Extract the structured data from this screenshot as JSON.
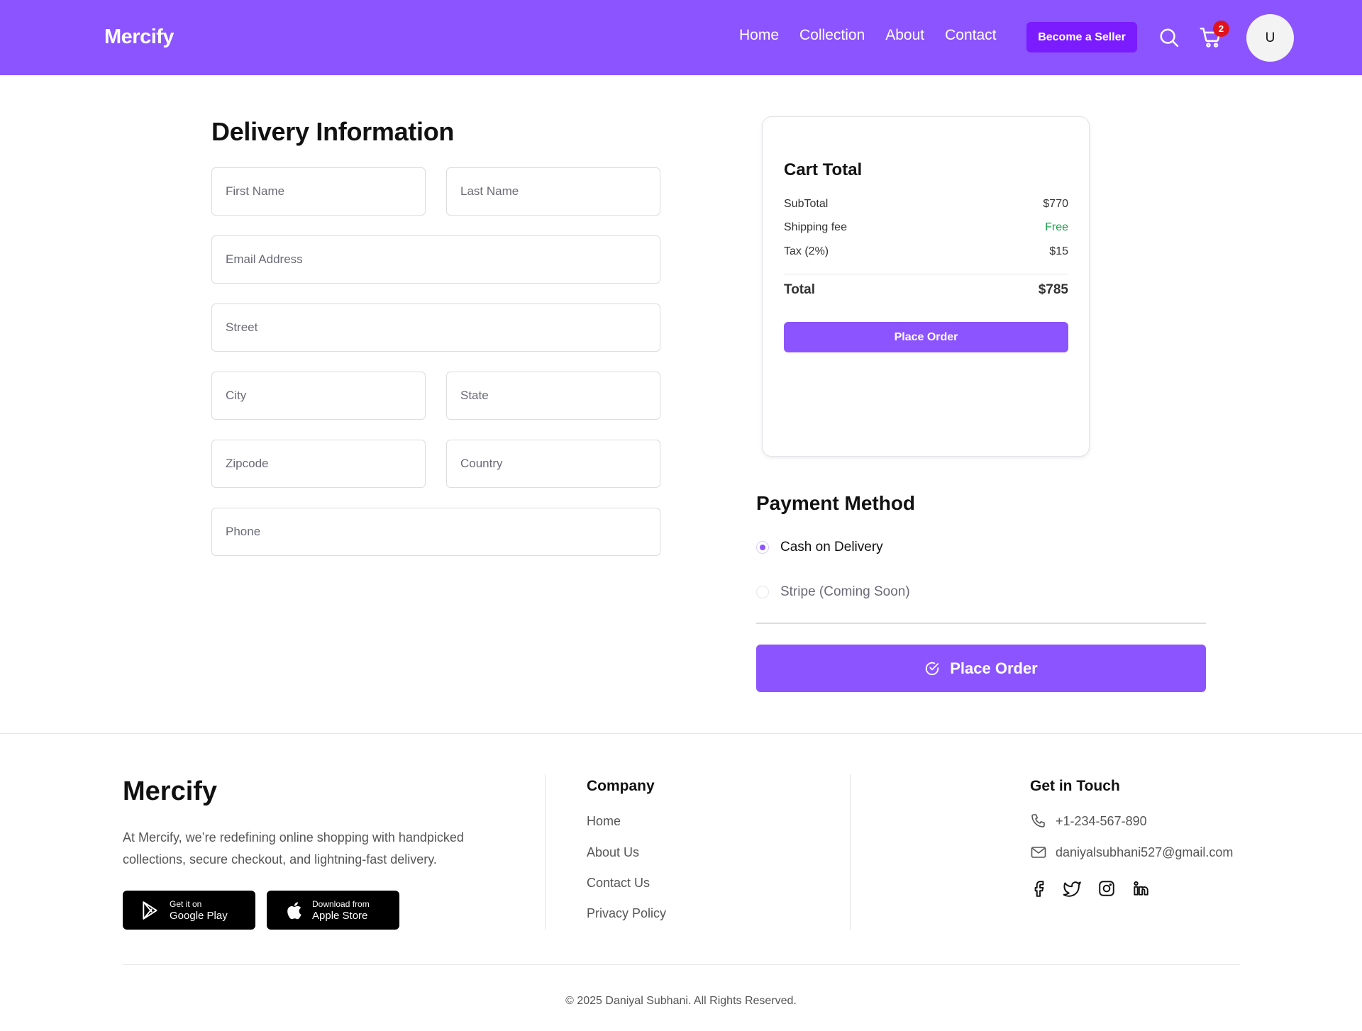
{
  "header": {
    "logo": "Mercify",
    "nav": [
      "Home",
      "Collection",
      "About",
      "Contact"
    ],
    "seller_button": "Become a Seller",
    "cart_count": "2",
    "avatar_initial": "U"
  },
  "delivery": {
    "title": "Delivery Information",
    "fields": {
      "first_name": "First Name",
      "last_name": "Last Name",
      "email": "Email Address",
      "street": "Street",
      "city": "City",
      "state": "State",
      "zipcode": "Zipcode",
      "country": "Country",
      "phone": "Phone"
    }
  },
  "cart": {
    "title": "Cart Total",
    "rows": [
      {
        "label": "SubTotal",
        "value": "$770"
      },
      {
        "label": "Shipping fee",
        "value": "Free"
      },
      {
        "label": "Tax (2%)",
        "value": "$15"
      }
    ],
    "total_label": "Total",
    "total_value": "$785",
    "button": "Place Order"
  },
  "payment": {
    "title": "Payment Method",
    "options": [
      {
        "label": "Cash on Delivery",
        "selected": true
      },
      {
        "label": "Stripe (Coming Soon)",
        "selected": false
      }
    ],
    "button": "Place Order",
    "accent_color": "#8c54ff"
  },
  "footer": {
    "brand": "Mercify",
    "about": "At Mercify, we’re redefining online shopping with handpicked collections, secure checkout, and lightning-fast delivery.",
    "google_play": {
      "small": "Get it on",
      "big": "Google Play"
    },
    "apple_store": {
      "small": "Download from",
      "big": "Apple Store"
    },
    "company_heading": "Company",
    "company_links": [
      "Home",
      "About Us",
      "Contact Us",
      "Privacy Policy"
    ],
    "contact_heading": "Get in Touch",
    "phone": "+1-234-567-890",
    "email": "daniyalsubhani527@gmail.com",
    "socials": [
      "facebook-icon",
      "twitter-icon",
      "instagram-icon",
      "linkedin-icon"
    ],
    "copyright": "© 2025 Daniyal Subhani. All Rights Reserved."
  }
}
